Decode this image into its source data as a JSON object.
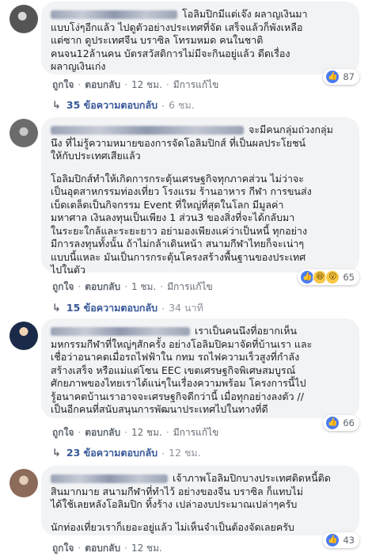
{
  "labels": {
    "like": "ถูกใจ",
    "reply": "ตอบกลับ",
    "edited": "มีการแก้ไข",
    "dot": "·",
    "reply_arrow": "↳"
  },
  "comments": [
    {
      "lines": [
        "โอลิมปิกมีแต่เจ๊ง ผลาญเงินมา",
        "แบบโง่ๆอีกแล้ว ไปดูตัวอย่างประเทศที่จัด เสร็จแล้วก็พังเหลือ",
        "แต่ซาก ดูประเทศจีน บราซิล โทรมหมด คนในชาติ",
        "คนจน12ล้านคน บัตรสวัสดิการไม่มีจะกินอยู่แล้ว ดีดเรื่อง",
        "ผลาญเงินเก่ง"
      ],
      "time": "12 ชม.",
      "reaction_count": "87",
      "replies_label": "35 ข้อความตอบกลับ",
      "replies_time": "6 ชม."
    },
    {
      "lines": [
        "จะมีคนกลุ่มถ่วงกลุ่ม",
        "นึง ที่ไม่รู้ความหมายของการจัดโอลิมปิกส์ ที่เป็นผลประโยชน์",
        "ให้กับประเทศเสียแล้ว"
      ],
      "para2": [
        "โอลิมปิกส์ทำให้เกิดการกระตุ้นเศรษฐกิจทุกภาคส่วน ไม่ว่าจะ",
        "เป็นอุตสาหกรรมท่องเที่ยว โรงแรม ร้านอาหาร กีฬา การขนส่ง",
        "เบ็ดเตล็ดเป็นกิจกรรม Event ที่ใหญ่ที่สุดในโลก มีมูลค่า",
        "มหาศาล เงินลงทุนเป็นเพียง 1 ส่วน3 ของสิ่งที่จะได้กลับมา",
        "ในระยะใกล้และระยะยาว อย่ามองเพียงแค่ว่าเป็นหนี้ ทุกอย่าง",
        "มีการลงทุนทั้งนั้น ถ้าไม่กล้าเดินหน้า สนามกีฬาไทยก็จะเน่าๆ",
        "แบบนี้แหละ มันเป็นการกระตุ้นโครงสร้างพื้นฐานของประเทศ",
        "ไปในตัว"
      ],
      "time": "1 ชม.",
      "reaction_count": "65",
      "replies_label": "15 ข้อความตอบกลับ",
      "replies_time": "34 นาที"
    },
    {
      "lines": [
        "เราเป็นคนนึงที่อยากเห็น",
        "มหกรรมกีฬาที่ใหญ่ๆสักครั้ง อย่างโอลิมปิคมาจัดที่บ้านเรา และ",
        "เชื่อว่าอนาคตเมื่อรถไฟฟ้าใน กทม รถไฟความเร็วสูงที่กำลัง",
        "สร้างเสร็จ หรือแม่แต่โซน EEC เขตเศรษฐกิจพิเศษสมบูรณ์",
        "ศักยภาพของไทยเราได้แน่ๆในเรื่องความพร้อม โครงการนี้ไป",
        "รู้อนาคตบ้านเราอาจจะเศรษฐกิจดีกว่านี้ เมื่อทุกอย่างลงตัว //",
        "เป็นอีกคนที่สนับสนุนการพัฒนาประเทศไปในทางที่ดี"
      ],
      "time": "12 ชม.",
      "reaction_count": "66",
      "replies_label": "23 ข้อความตอบกลับ",
      "replies_time": "12 ชม."
    },
    {
      "lines": [
        "เจ้าภาพโอลิมปิกบางประเทศติดหนี้ติด",
        "สินมากมาย สนามกีฬาที่ทำไว้ อย่างของจีน บราซิล ก็แทบไม่",
        "ได้ใช้เลยหลังโอลิมปิก ทิ้งร้าง เปล่าองบประมาณเปล่าๆครับ"
      ],
      "para2": [
        "นักท่องเที่ยวเราก็เยอะอยู่แล้ว ไม่เห็นจำเป็นต้องจัดเลยครับ"
      ],
      "time": "12 ชม.",
      "reaction_count": "43"
    }
  ]
}
